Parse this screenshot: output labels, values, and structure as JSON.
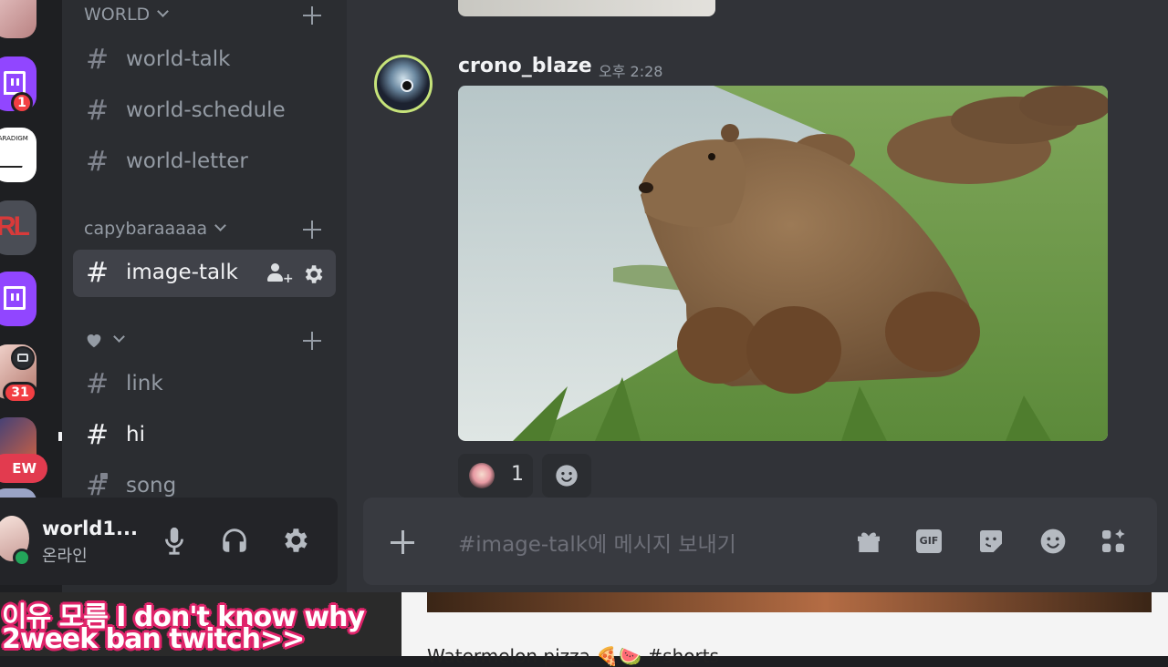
{
  "servers": {
    "badges": [
      "1",
      "31"
    ],
    "paradigm_label": "PARADIGM",
    "new_pill": "EW"
  },
  "sidebar": {
    "categories": [
      {
        "label": "WORLD"
      },
      {
        "label": "capybaraaaaa"
      },
      {
        "label": "",
        "icon": "heart-icon"
      }
    ],
    "channels": [
      {
        "name": "world-talk"
      },
      {
        "name": "world-schedule"
      },
      {
        "name": "world-letter"
      },
      {
        "name": "image-talk"
      },
      {
        "name": "link"
      },
      {
        "name": "hi"
      },
      {
        "name": "song"
      }
    ]
  },
  "user_panel": {
    "username": "world1...",
    "status": "온라인"
  },
  "message": {
    "author": "crono_blaze",
    "time": "오후 2:28",
    "reaction_count": "1"
  },
  "composer": {
    "placeholder": "#image-talk에 메시지 보내기",
    "gif_label": "GIF"
  },
  "overlay": {
    "subtitle_line1": "이유 모름 I don't know why",
    "subtitle_line2": "2week ban twitch>>",
    "video_title": "Watermelon pizza 🍕🍉 #shorts"
  },
  "colors": {
    "background": "#313338",
    "sidebar": "#2b2d31",
    "rail": "#1e1f22",
    "active_channel": "#404249",
    "online": "#23a55a",
    "badge": "#f23f43",
    "twitch": "#9146ff"
  }
}
